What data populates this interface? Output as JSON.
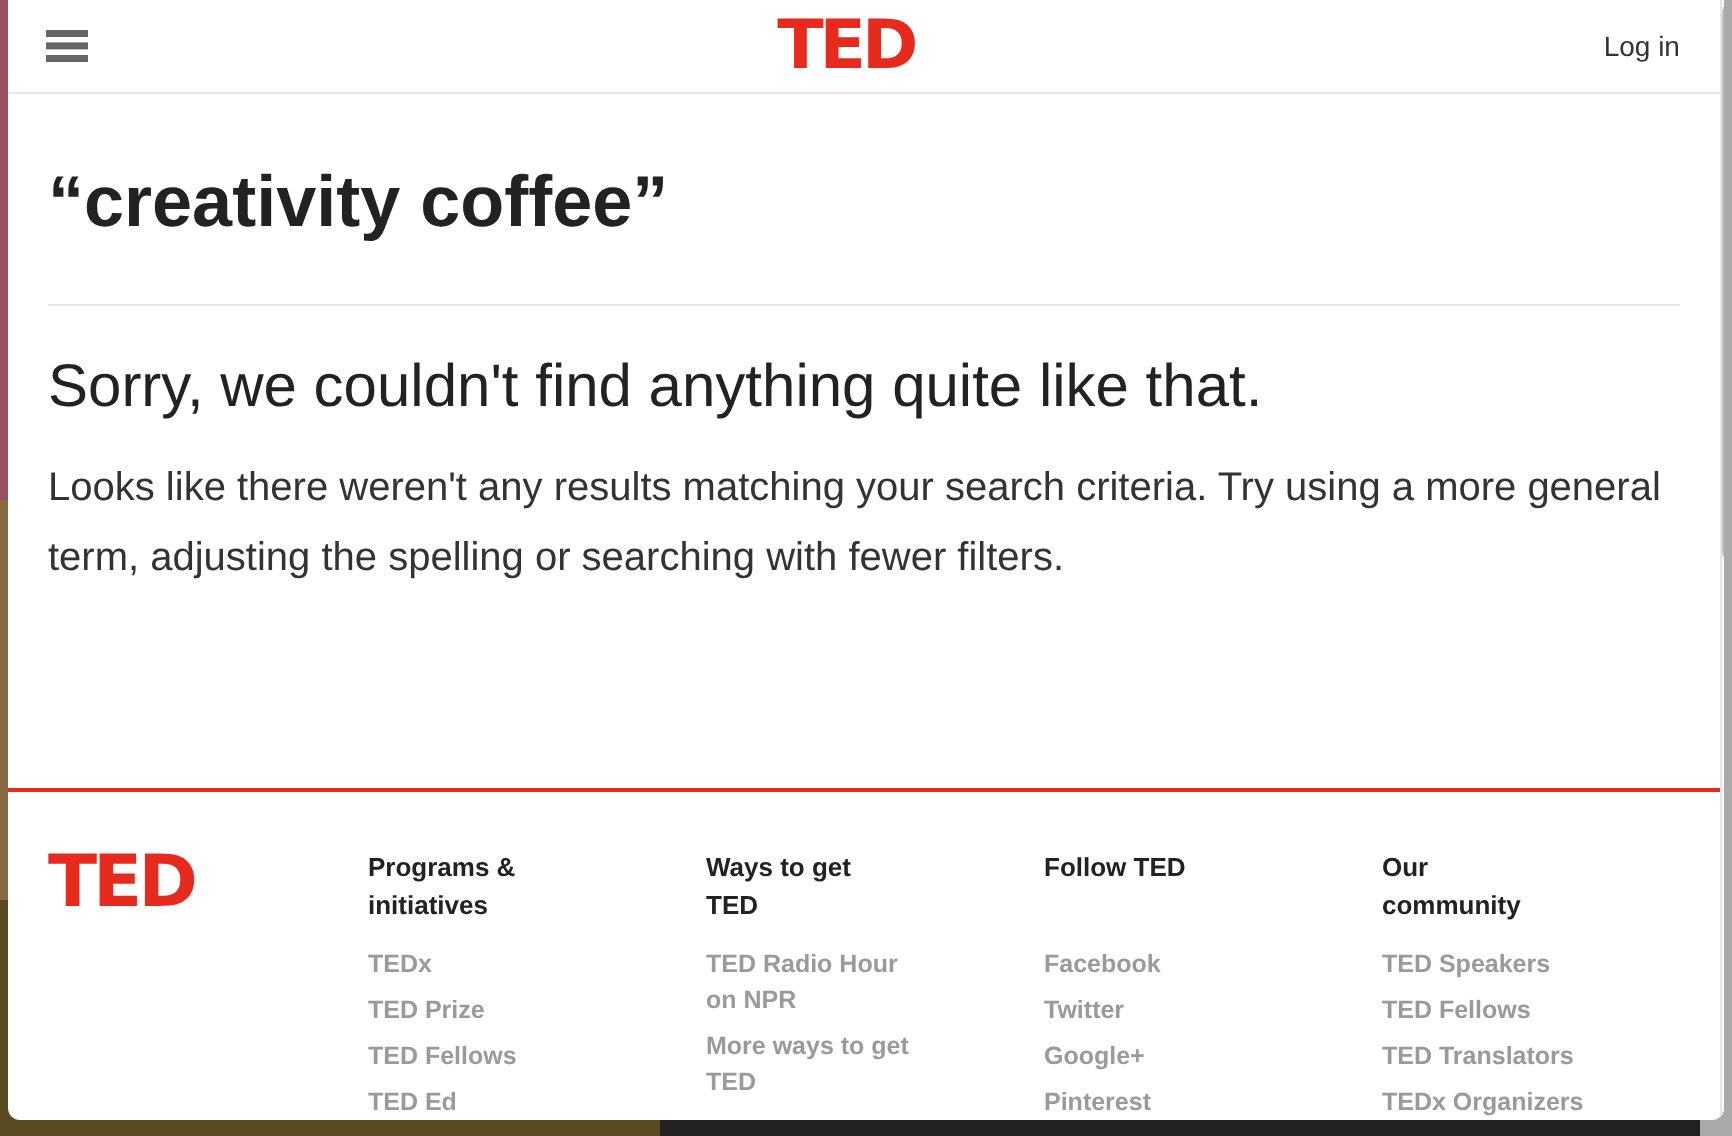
{
  "header": {
    "logo": "TED",
    "login": "Log in"
  },
  "search": {
    "query": "“creativity coffee”",
    "message": "Sorry, we couldn't find anything quite like that.",
    "detail": "Looks like there weren't any results matching your search criteria. Try using a more general term, adjusting the spelling or searching with fewer filters."
  },
  "footer": {
    "logo": "TED",
    "columns": [
      {
        "title": "Programs & initiatives",
        "links": [
          "TEDx",
          "TED Prize",
          "TED Fellows",
          "TED Ed"
        ]
      },
      {
        "title": "Ways to get TED",
        "links": [
          "TED Radio Hour on NPR",
          "More ways to get TED"
        ]
      },
      {
        "title": "Follow TED",
        "links": [
          "Facebook",
          "Twitter",
          "Google+",
          "Pinterest"
        ]
      },
      {
        "title": "Our community",
        "links": [
          "TED Speakers",
          "TED Fellows",
          "TED Translators",
          "TEDx Organizers"
        ]
      }
    ]
  }
}
